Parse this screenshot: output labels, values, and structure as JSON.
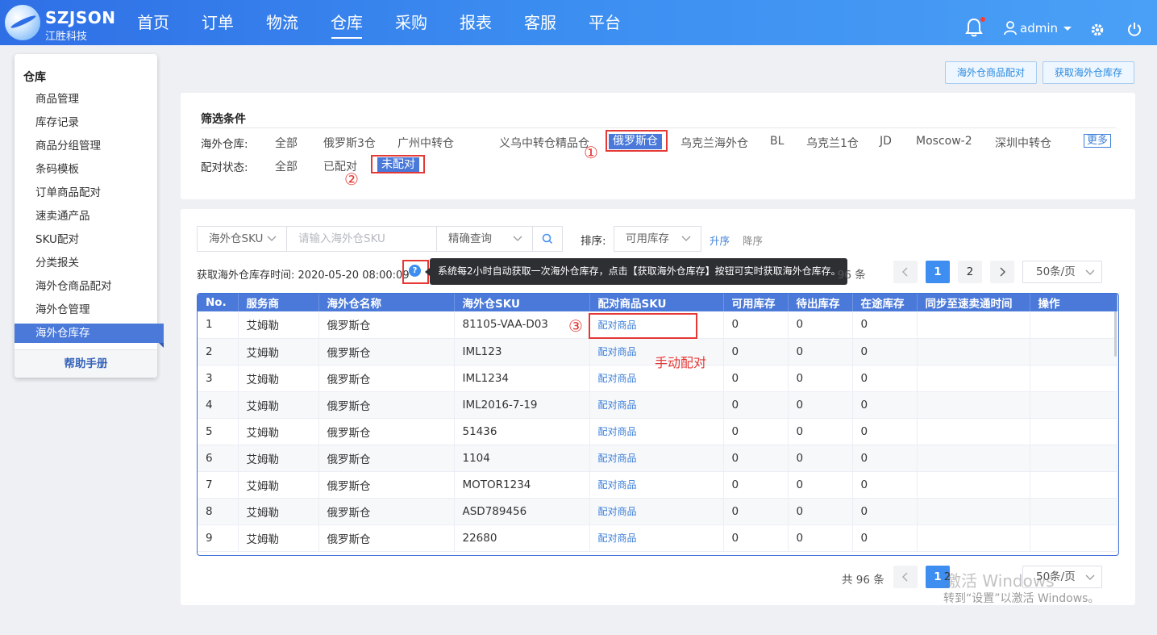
{
  "header": {
    "brand": "SZJSON",
    "brand_sub": "江胜科技",
    "nav": [
      "首页",
      "订单",
      "物流",
      "仓库",
      "采购",
      "报表",
      "客服",
      "平台"
    ],
    "active_nav": "仓库",
    "user": "admin",
    "icons": [
      "bell-icon",
      "user-icon",
      "gear-icon",
      "power-icon"
    ]
  },
  "sidebar": {
    "title": "仓库",
    "items": [
      "商品管理",
      "库存记录",
      "商品分组管理",
      "条码模板",
      "订单商品配对",
      "速卖通产品",
      "SKU配对",
      "分类报关",
      "海外仓商品配对",
      "海外仓管理",
      "海外仓库存"
    ],
    "active": "海外仓库存",
    "help": "帮助手册"
  },
  "actions": {
    "match_goods": "海外仓商品配对",
    "fetch_stock": "获取海外仓库存"
  },
  "filter": {
    "title": "筛选条件",
    "warehouse_label": "海外仓库:",
    "warehouses": [
      "全部",
      "俄罗斯3仓",
      "广州中转仓",
      "义乌中转仓",
      "精品仓",
      "俄罗斯仓",
      "乌克兰海外仓",
      "BL",
      "乌克兰1仓",
      "JD",
      "Moscow-2",
      "深圳中转仓"
    ],
    "selected_warehouse": "俄罗斯仓",
    "more": "更多",
    "status_label": "配对状态:",
    "statuses": [
      "全部",
      "已配对",
      "未配对"
    ],
    "selected_status": "未配对",
    "annotations": [
      "①",
      "②",
      "③"
    ]
  },
  "toolbar": {
    "field_select": "海外仓SKU",
    "search_placeholder": "请输入海外仓SKU",
    "mode_select": "精确查询",
    "sort_label": "排序:",
    "sort_select": "可用库存",
    "asc": "升序",
    "desc": "降序"
  },
  "sync_info": {
    "label": "获取海外仓库存时间:",
    "time": "2020-05-20 08:00:09",
    "tooltip": "系统每2小时自动获取一次海外仓库存，点击【获取海外仓库存】按钮可实时获取海外仓库存。"
  },
  "pager": {
    "total": "共 96 条",
    "pages": [
      "1",
      "2"
    ],
    "current": "1",
    "size": "50条/页"
  },
  "table": {
    "columns": [
      "No.",
      "服务商",
      "海外仓名称",
      "海外仓SKU",
      "配对商品SKU",
      "可用库存",
      "待出库存",
      "在途库存",
      "同步至速卖通时间",
      "操作"
    ],
    "rows": [
      {
        "no": "1",
        "provider": "艾姆勒",
        "warehouse": "俄罗斯仓",
        "sku": "81105-VAA-D03",
        "match": "配对商品",
        "avail": "0",
        "pending": "0",
        "transit": "0"
      },
      {
        "no": "2",
        "provider": "艾姆勒",
        "warehouse": "俄罗斯仓",
        "sku": "IML123",
        "match": "配对商品",
        "avail": "0",
        "pending": "0",
        "transit": "0"
      },
      {
        "no": "3",
        "provider": "艾姆勒",
        "warehouse": "俄罗斯仓",
        "sku": "IML1234",
        "match": "配对商品",
        "avail": "0",
        "pending": "0",
        "transit": "0"
      },
      {
        "no": "4",
        "provider": "艾姆勒",
        "warehouse": "俄罗斯仓",
        "sku": "IML2016-7-19",
        "match": "配对商品",
        "avail": "0",
        "pending": "0",
        "transit": "0"
      },
      {
        "no": "5",
        "provider": "艾姆勒",
        "warehouse": "俄罗斯仓",
        "sku": "51436",
        "match": "配对商品",
        "avail": "0",
        "pending": "0",
        "transit": "0"
      },
      {
        "no": "6",
        "provider": "艾姆勒",
        "warehouse": "俄罗斯仓",
        "sku": "1104",
        "match": "配对商品",
        "avail": "0",
        "pending": "0",
        "transit": "0"
      },
      {
        "no": "7",
        "provider": "艾姆勒",
        "warehouse": "俄罗斯仓",
        "sku": "MOTOR1234",
        "match": "配对商品",
        "avail": "0",
        "pending": "0",
        "transit": "0"
      },
      {
        "no": "8",
        "provider": "艾姆勒",
        "warehouse": "俄罗斯仓",
        "sku": "ASD789456",
        "match": "配对商品",
        "avail": "0",
        "pending": "0",
        "transit": "0"
      },
      {
        "no": "9",
        "provider": "艾姆勒",
        "warehouse": "俄罗斯仓",
        "sku": "22680",
        "match": "配对商品",
        "avail": "0",
        "pending": "0",
        "transit": "0"
      }
    ],
    "manual_note": "手动配对"
  },
  "watermark": {
    "line1": "激活 Windows",
    "line2": "转到“设置”以激活 Windows。"
  },
  "colors": {
    "header_start": "#2f6fe6",
    "header_end": "#4aa0f6",
    "accent": "#4a79d9",
    "link": "#3d7fd8",
    "annotation_red": "#e53935"
  }
}
